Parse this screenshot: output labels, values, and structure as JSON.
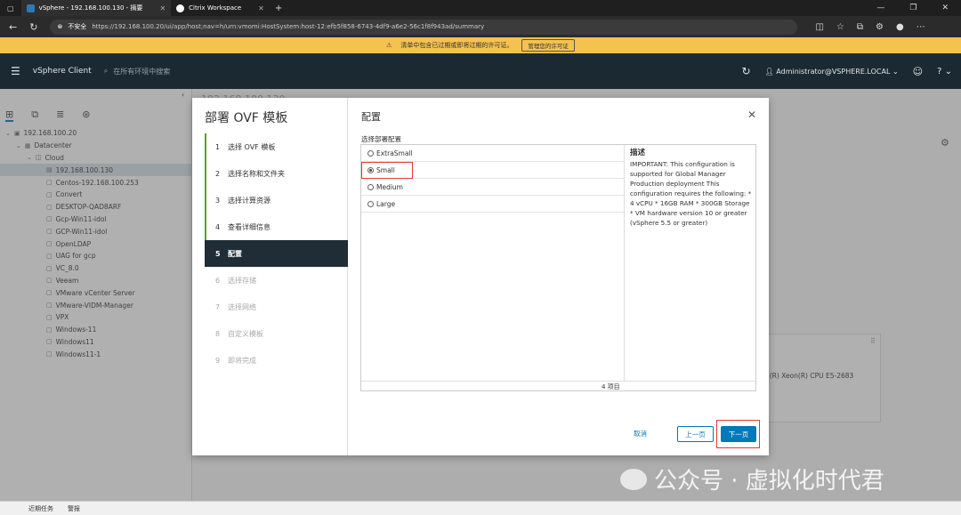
{
  "browser": {
    "tabs": [
      {
        "label": "vSphere - 192.168.100.130 - 摘要",
        "active": true
      },
      {
        "label": "Citrix Workspace",
        "active": false
      }
    ],
    "new_tab": "+",
    "insecure_label": "不安全",
    "url": "https://192.168.100.20/ui/app/host;nav=h/urn:vmomi:HostSystem:host-12:efb5f858-6743-4df9-a6e2-56c1f8f943ad/summary"
  },
  "license_banner": {
    "text": "清单中包含已过期或即将过期的许可证。",
    "button": "管理您的许可证"
  },
  "header": {
    "app_name": "vSphere Client",
    "search_placeholder": "在所有环境中搜索",
    "user": "Administrator@VSPHERE.LOCAL"
  },
  "sidebar": {
    "tree": [
      {
        "label": "192.168.100.20",
        "level": 0,
        "icon": "vcenter-icon"
      },
      {
        "label": "Datacenter",
        "level": 1,
        "icon": "datacenter-icon"
      },
      {
        "label": "Cloud",
        "level": 2,
        "icon": "cluster-icon"
      },
      {
        "label": "192.168.100.130",
        "level": 3,
        "icon": "host-icon",
        "selected": true
      },
      {
        "label": "Centos-192.168.100.253",
        "level": 3,
        "icon": "vm-icon"
      },
      {
        "label": "Convert",
        "level": 3,
        "icon": "vm-icon"
      },
      {
        "label": "DESKTOP-QAD8ARF",
        "level": 3,
        "icon": "vm-icon"
      },
      {
        "label": "Gcp-Win11-idol",
        "level": 3,
        "icon": "vm-icon"
      },
      {
        "label": "GCP-Win11-idol",
        "level": 3,
        "icon": "vm-icon"
      },
      {
        "label": "OpenLDAP",
        "level": 3,
        "icon": "vm-icon"
      },
      {
        "label": "UAG for gcp",
        "level": 3,
        "icon": "vm-icon"
      },
      {
        "label": "VC_8.0",
        "level": 3,
        "icon": "vm-icon"
      },
      {
        "label": "Veeam",
        "level": 3,
        "icon": "vm-icon"
      },
      {
        "label": "VMware vCenter Server",
        "level": 3,
        "icon": "vm-icon"
      },
      {
        "label": "VMware-VIDM-Manager",
        "level": 3,
        "icon": "vm-icon"
      },
      {
        "label": "VPX",
        "level": 3,
        "icon": "vm-icon"
      },
      {
        "label": "Windows-11",
        "level": 3,
        "icon": "vm-icon"
      },
      {
        "label": "Windows11",
        "level": 3,
        "icon": "vm-icon"
      },
      {
        "label": "Windows11-1",
        "level": 3,
        "icon": "vm-icon"
      }
    ]
  },
  "main": {
    "title": "192.168.100.130",
    "bg_card_text": "el(R) Xeon(R) CPU E5-2683"
  },
  "bottom": {
    "recent_tasks": "近期任务",
    "alarms": "警报"
  },
  "modal": {
    "title": "部署 OVF 模板",
    "steps": [
      {
        "num": "1",
        "label": "选择 OVF 模板",
        "state": "done"
      },
      {
        "num": "2",
        "label": "选择名称和文件夹",
        "state": "done"
      },
      {
        "num": "3",
        "label": "选择计算资源",
        "state": "done"
      },
      {
        "num": "4",
        "label": "查看详细信息",
        "state": "done"
      },
      {
        "num": "5",
        "label": "配置",
        "state": "active"
      },
      {
        "num": "6",
        "label": "选择存储",
        "state": "pending"
      },
      {
        "num": "7",
        "label": "选择网络",
        "state": "pending"
      },
      {
        "num": "8",
        "label": "自定义模板",
        "state": "pending"
      },
      {
        "num": "9",
        "label": "即将完成",
        "state": "pending"
      }
    ],
    "section_title": "配置",
    "config_label": "选择部署配置",
    "options": [
      {
        "label": "ExtraSmall",
        "selected": false
      },
      {
        "label": "Small",
        "selected": true
      },
      {
        "label": "Medium",
        "selected": false
      },
      {
        "label": "Large",
        "selected": false
      }
    ],
    "description_title": "描述",
    "description": "IMPORTANT: This configuration is supported for Global Manager Production deployment This configuration requires the following: * 4 vCPU * 16GB RAM * 300GB Storage * VM hardware version 10 or greater (vSphere 5.5 or greater)",
    "item_count": "4 项目",
    "cancel": "取消",
    "back": "上一页",
    "next": "下一页"
  },
  "watermark": "公众号 · 虚拟化时代君",
  "colors": {
    "accent": "#0079b8",
    "highlight": "#e53935",
    "banner": "#f5c24f",
    "header": "#1b2a32"
  }
}
